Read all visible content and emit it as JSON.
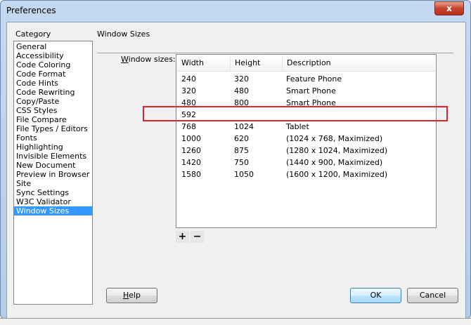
{
  "window": {
    "title": "Preferences",
    "close": "x"
  },
  "category": {
    "label": "Category",
    "items": [
      "General",
      "Accessibility",
      "Code Coloring",
      "Code Format",
      "Code Hints",
      "Code Rewriting",
      "Copy/Paste",
      "CSS Styles",
      "File Compare",
      "File Types / Editors",
      "Fonts",
      "Highlighting",
      "Invisible Elements",
      "New Document",
      "Preview in Browser",
      "Site",
      "Sync Settings",
      "W3C Validator",
      "Window Sizes"
    ],
    "selected": "Window Sizes"
  },
  "panel": {
    "title": "Window Sizes",
    "label_prefix": "W",
    "label_rest": "indow sizes:"
  },
  "table": {
    "headers": [
      "Width",
      "Height",
      "Description"
    ],
    "rows": [
      [
        "240",
        "320",
        "Feature Phone"
      ],
      [
        "320",
        "480",
        "Smart Phone"
      ],
      [
        "480",
        "800",
        "Smart Phone"
      ],
      [
        "592",
        "",
        ""
      ],
      [
        "768",
        "1024",
        "Tablet"
      ],
      [
        "1000",
        "620",
        "(1024 x 768, Maximized)"
      ],
      [
        "1260",
        "875",
        "(1280 x 1024, Maximized)"
      ],
      [
        "1420",
        "750",
        "(1440 x 900, Maximized)"
      ],
      [
        "1580",
        "1050",
        "(1600 x 1200, Maximized)"
      ]
    ]
  },
  "controls": {
    "add": "+",
    "remove": "−"
  },
  "buttons": {
    "help_prefix": "H",
    "help_rest": "elp",
    "ok": "OK",
    "cancel": "Cancel"
  },
  "colors": {
    "selection": "#3399ff",
    "highlight": "#d9252b"
  }
}
